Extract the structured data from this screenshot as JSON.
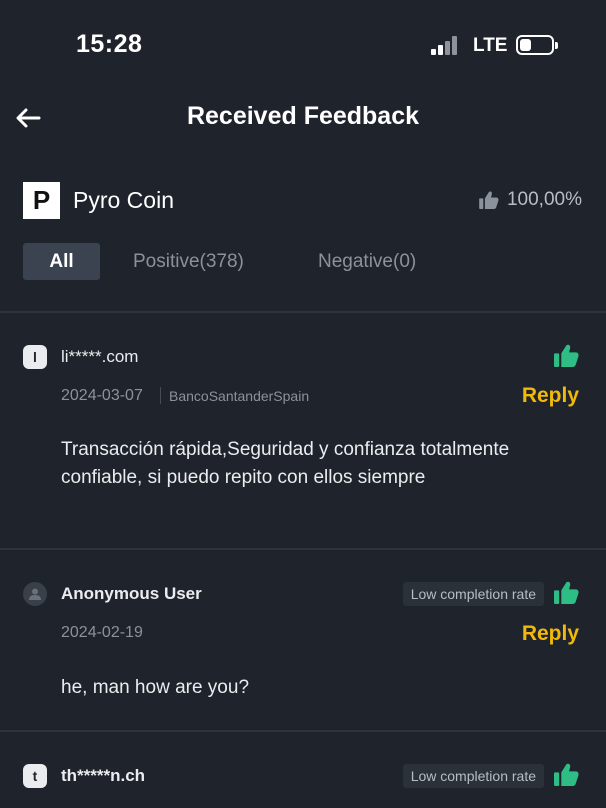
{
  "status_bar": {
    "time": "15:28",
    "network": "LTE"
  },
  "header": {
    "title": "Received Feedback",
    "back_icon": "arrow-left-icon"
  },
  "merchant": {
    "logo_letter": "P",
    "name": "Pyro Coin",
    "rating": "100,00%",
    "rating_icon": "thumbs-up-icon"
  },
  "tabs": [
    {
      "label": "All",
      "active": true
    },
    {
      "label": "Positive(378)",
      "active": false
    },
    {
      "label": "Negative(0)",
      "active": false
    }
  ],
  "colors": {
    "background": "#1f232b",
    "accent": "#f0b90b",
    "positive": "#2ebd85",
    "muted": "#8b929c"
  },
  "feedback": [
    {
      "avatar_letter": "l",
      "user": "li*****.com",
      "date": "2024-03-07",
      "payment_method": "BancoSantanderSpain",
      "badge": "",
      "reply_label": "Reply",
      "comment": "Transacción rápida,Seguridad y confianza totalmente confiable, si puedo repito con ellos siempre",
      "type": "positive"
    },
    {
      "avatar_letter": "",
      "user": "Anonymous User",
      "date": "2024-02-19",
      "payment_method": "",
      "badge": "Low completion rate",
      "reply_label": "Reply",
      "comment": "he, man how are you?",
      "type": "positive"
    },
    {
      "avatar_letter": "t",
      "user": "th*****n.ch",
      "date": "",
      "payment_method": "",
      "badge": "Low completion rate",
      "reply_label": "",
      "comment": "",
      "type": "positive"
    }
  ]
}
